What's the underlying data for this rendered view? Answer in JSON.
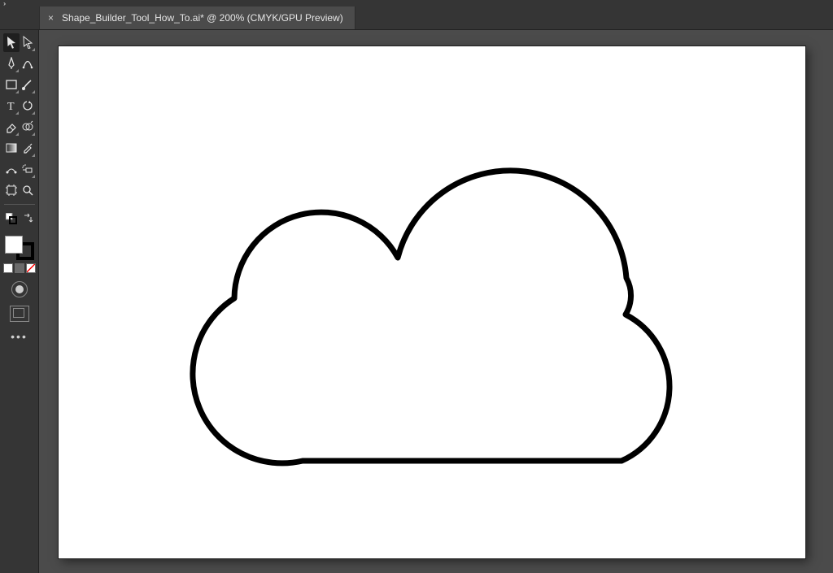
{
  "tab": {
    "title": "Shape_Builder_Tool_How_To.ai* @ 200% (CMYK/GPU Preview)"
  },
  "tools": {
    "selection": "Selection Tool",
    "direct": "Direct Selection Tool",
    "pen": "Pen Tool",
    "curvature": "Curvature Tool",
    "rectangle": "Rectangle Tool",
    "brush": "Paintbrush Tool",
    "type": "Type Tool",
    "rotate": "Rotate Tool",
    "eraser": "Eraser Tool",
    "shapebuilder": "Shape Builder Tool",
    "gradient": "Gradient Tool",
    "eyedropper": "Eyedropper Tool",
    "blend": "Blend Tool",
    "symbolsprayer": "Symbol Sprayer Tool",
    "artboard": "Artboard Tool",
    "zoom": "Zoom Tool"
  },
  "colors": {
    "fill": "#ffffff",
    "stroke": "#000000"
  },
  "artwork": {
    "kind": "cloud-outline",
    "stroke": "#000000",
    "stroke_width_px": 7
  }
}
